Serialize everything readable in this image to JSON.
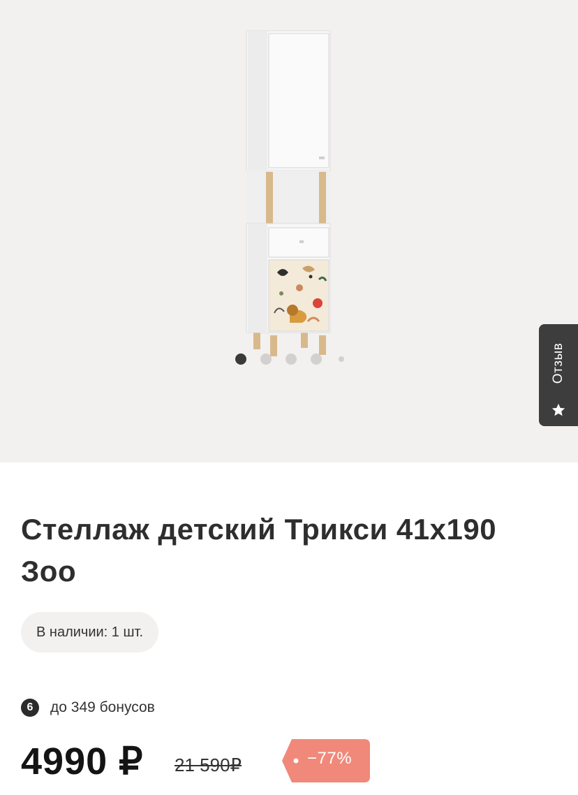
{
  "product": {
    "title": "Стеллаж детский Трикси 41х190 Зоо",
    "stock": "В наличии: 1 шт.",
    "bonus_count": "6",
    "bonus_text": "до 349 бонусов",
    "price": "4990 ₽",
    "old_price": "21 590₽",
    "discount": "−77%"
  },
  "gallery": {
    "slide_count": 5,
    "active_slide": 1
  },
  "review_tab": {
    "label": "Отзыв",
    "icon": "star-icon"
  },
  "colors": {
    "gallery_bg": "#f3f1ef",
    "review_tab_bg": "#3d3d3d",
    "discount_bg": "#f08979",
    "price": "#141414"
  }
}
